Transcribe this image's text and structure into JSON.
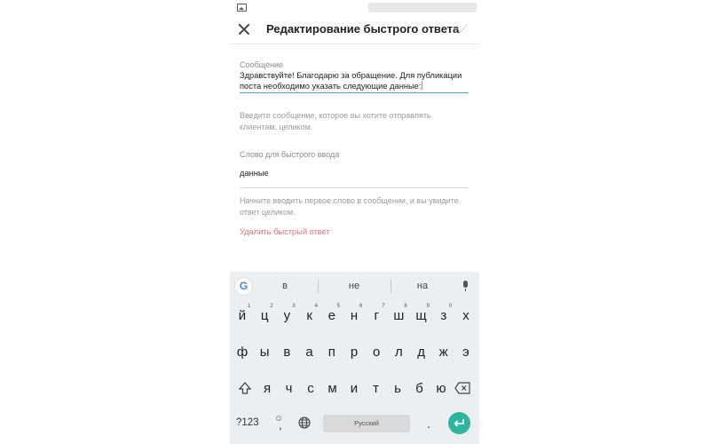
{
  "app_bar": {
    "title": "Редактирование быстрого ответа",
    "accent_color": "#5aa2c6"
  },
  "form": {
    "message": {
      "label": "Сообщение",
      "value": "Здравствуйте! Благодарю за обращение. Для публикации поста необходимо указать следующие данные:",
      "hint": "Введите сообщение, которое вы хотите отправлять клиентам, целиком."
    },
    "shortcut": {
      "label": "Слово для быстрого ввода",
      "value": "данные",
      "hint": "Начните вводить первое слово в сообщении, и вы увидите ответ целиком."
    },
    "delete_label": "Удалить быстрый ответ",
    "delete_color": "#e2717a"
  },
  "keyboard": {
    "suggestions": [
      "в",
      "не",
      "на"
    ],
    "row1": [
      "й",
      "ц",
      "у",
      "к",
      "е",
      "н",
      "г",
      "ш",
      "щ",
      "з",
      "х"
    ],
    "row1_hints": [
      "1",
      "2",
      "3",
      "4",
      "5",
      "6",
      "7",
      "8",
      "9",
      "0"
    ],
    "row2": [
      "ф",
      "ы",
      "в",
      "а",
      "п",
      "р",
      "о",
      "л",
      "д",
      "ж",
      "э"
    ],
    "row3": [
      "я",
      "ч",
      "с",
      "м",
      "и",
      "т",
      "ь",
      "б",
      "ю"
    ],
    "symbols_label": "?123",
    "comma": ",",
    "emoji_hint": "☺",
    "space_label": "Русский",
    "period": ".",
    "enter_color": "#2eb5a0",
    "icons": [
      "google-icon",
      "microphone-icon",
      "shift-icon",
      "backspace-icon",
      "globe-icon",
      "enter-icon"
    ]
  }
}
